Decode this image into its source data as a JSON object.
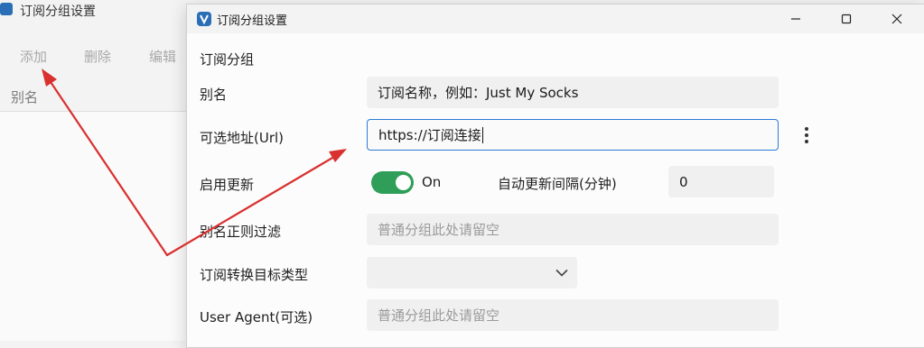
{
  "bg_window": {
    "title": "订阅分组设置",
    "toolbar": {
      "add": "添加",
      "delete": "删除",
      "edit": "编辑"
    },
    "column_header": "别名"
  },
  "dialog": {
    "title": "订阅分组设置",
    "section_title": "订阅分组",
    "fields": {
      "alias": {
        "label": "别名",
        "value": "订阅名称，例如：Just My Socks"
      },
      "url": {
        "label": "可选地址(Url)",
        "value": "https://订阅连接"
      },
      "enable_update": {
        "label": "启用更新",
        "toggle_state": "On",
        "enabled": true
      },
      "update_interval": {
        "label": "自动更新间隔(分钟)",
        "value": "0"
      },
      "alias_filter": {
        "label": "别名正则过滤",
        "placeholder": "普通分组此处请留空"
      },
      "convert_target": {
        "label": "订阅转换目标类型",
        "value": ""
      },
      "user_agent": {
        "label": "User Agent(可选)",
        "placeholder": "普通分组此处请留空"
      }
    }
  },
  "colors": {
    "accent": "#2b7ad6",
    "toggle_on": "#2e9e58",
    "annotation_arrow": "#d93030"
  },
  "icons": [
    "app-logo-icon",
    "minimize-icon",
    "maximize-icon",
    "close-icon",
    "more-options-icon",
    "chevron-down-icon"
  ]
}
